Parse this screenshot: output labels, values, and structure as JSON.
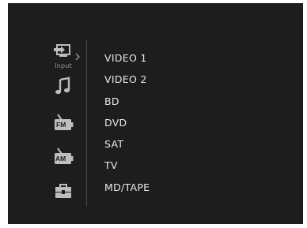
{
  "sidebar": {
    "input_label": "Input",
    "icons": [
      "input-icon",
      "music-note-icon",
      "fm-radio-icon",
      "am-radio-icon",
      "setup-toolbox-icon"
    ],
    "fm_badge": "FM",
    "am_badge": "AM"
  },
  "colors": {
    "background": "#1d1d1d",
    "icon": "#b8b8b8",
    "text": "#e8e8e8",
    "divider": "#4a4a4a"
  },
  "sources": [
    "VIDEO 1",
    "VIDEO 2",
    "BD",
    "DVD",
    "SAT",
    "TV",
    "MD/TAPE"
  ]
}
